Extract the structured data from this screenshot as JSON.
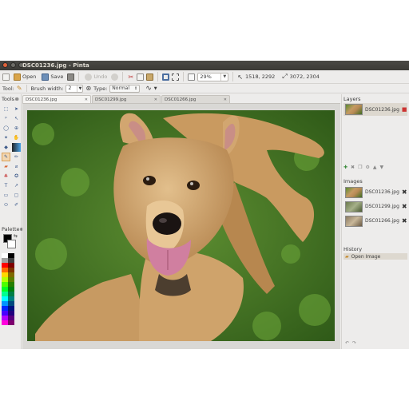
{
  "window": {
    "title": "DSC01236.jpg - Pinta"
  },
  "toolbar": {
    "open_label": "Open",
    "save_label": "Save",
    "undo_label": "Undo",
    "zoom_value": "29%",
    "cursor_position": "1518, 2292",
    "image_size": "3072, 2304"
  },
  "options": {
    "tool_label": "Tool:",
    "brush_width_label": "Brush width:",
    "brush_width_value": "2",
    "type_label": "Type:",
    "type_value": "Normal"
  },
  "tools_panel": {
    "header": "Tools"
  },
  "palette": {
    "header": "Palette",
    "primary_color": "#000000",
    "secondary_color": "#ffffff"
  },
  "tabs": [
    {
      "label": "DSC01236.jpg",
      "active": true
    },
    {
      "label": "DSC01299.jpg",
      "active": false
    },
    {
      "label": "DSC01266.jpg",
      "active": false
    }
  ],
  "layers": {
    "header": "Layers",
    "items": [
      {
        "label": "DSC01236.jpg"
      }
    ]
  },
  "images": {
    "header": "Images",
    "items": [
      {
        "label": "DSC01236.jpg"
      },
      {
        "label": "DSC01299.jpg"
      },
      {
        "label": "DSC01266.jpg"
      }
    ]
  },
  "history": {
    "header": "History",
    "items": [
      {
        "label": "Open Image"
      }
    ]
  },
  "colors": {
    "accent": "#e0623a",
    "selection": "#ddd8cf",
    "canvas_bg": "#d9d8d5"
  }
}
